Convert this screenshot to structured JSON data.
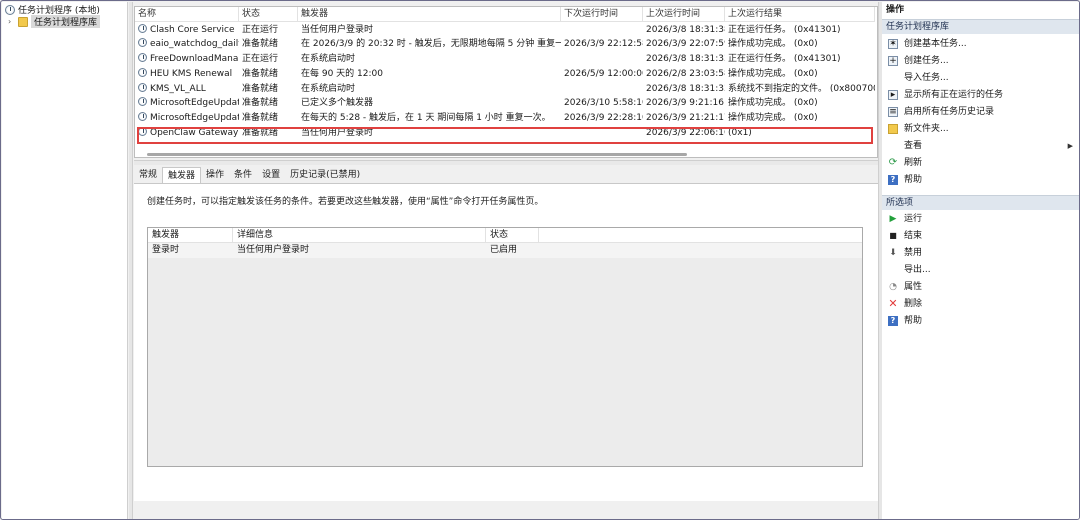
{
  "tree": {
    "root": "任务计划程序 (本地)",
    "library": "任务计划程序库"
  },
  "task_list": {
    "columns": [
      "名称",
      "状态",
      "触发器",
      "下次运行时间",
      "上次运行时间",
      "上次运行结果"
    ],
    "rows": [
      {
        "name": "Clash Core Service",
        "status": "正在运行",
        "trigger": "当任何用户登录时",
        "next": "",
        "last": "2026/3/8 18:31:38",
        "result": "正在运行任务。 (0x41301)"
      },
      {
        "name": "eaio_watchdog_daily",
        "status": "准备就绪",
        "trigger": "在 2026/3/9 的 20:32 时 - 触发后，无限期地每隔 5 分钟 重复一次。",
        "next": "2026/3/9 22:12:58",
        "last": "2026/3/9 22:07:59",
        "result": "操作成功完成。 (0x0)"
      },
      {
        "name": "FreeDownloadMana...",
        "status": "正在运行",
        "trigger": "在系统启动时",
        "next": "",
        "last": "2026/3/8 18:31:33",
        "result": "正在运行任务。 (0x41301)"
      },
      {
        "name": "HEU KMS Renewal",
        "status": "准备就绪",
        "trigger": "在每 90 天的 12:00",
        "next": "2026/5/9 12:00:00",
        "last": "2026/2/8 23:03:58",
        "result": "操作成功完成。 (0x0)"
      },
      {
        "name": "KMS_VL_ALL",
        "status": "准备就绪",
        "trigger": "在系统启动时",
        "next": "",
        "last": "2026/3/8 18:31:33",
        "result": "系统找不到指定的文件。 (0x80070002"
      },
      {
        "name": "MicrosoftEdgeUpdat...",
        "status": "准备就绪",
        "trigger": "已定义多个触发器",
        "next": "2026/3/10 5:58:10",
        "last": "2026/3/9 9:21:16",
        "result": "操作成功完成。 (0x0)"
      },
      {
        "name": "MicrosoftEdgeUpdat...",
        "status": "准备就绪",
        "trigger": "在每天的 5:28 - 触发后，在 1 天 期间每隔 1 小时 重复一次。",
        "next": "2026/3/9 22:28:10",
        "last": "2026/3/9 21:21:17",
        "result": "操作成功完成。 (0x0)"
      },
      {
        "name": "OpenClaw Gateway",
        "status": "准备就绪",
        "trigger": "当任何用户登录时",
        "next": "",
        "last": "2026/3/9 22:06:16",
        "result": "(0x1)"
      }
    ]
  },
  "detail": {
    "tabs": [
      "常规",
      "触发器",
      "操作",
      "条件",
      "设置",
      "历史记录(已禁用)"
    ],
    "active_tab": "触发器",
    "hint": "创建任务时，可以指定触发该任务的条件。若要更改这些触发器，使用“属性”命令打开任务属性页。",
    "trigger_table": {
      "columns": [
        "触发器",
        "详细信息",
        "状态"
      ],
      "rows": [
        {
          "trigger": "登录时",
          "details": "当任何用户登录时",
          "status": "已启用"
        }
      ]
    }
  },
  "actions": {
    "title": "操作",
    "section1": "任务计划程序库",
    "items1": [
      {
        "label": "创建基本任务...",
        "icon": "create-basic-task-icon"
      },
      {
        "label": "创建任务...",
        "icon": "create-task-icon"
      },
      {
        "label": "导入任务...",
        "icon": ""
      },
      {
        "label": "显示所有正在运行的任务",
        "icon": "running-tasks-icon"
      },
      {
        "label": "启用所有任务历史记录",
        "icon": "history-icon"
      },
      {
        "label": "新文件夹...",
        "icon": "folder-icon"
      },
      {
        "label": "查看",
        "icon": ""
      },
      {
        "label": "刷新",
        "icon": "refresh-icon"
      },
      {
        "label": "帮助",
        "icon": "help-icon"
      }
    ],
    "section2": "所选项",
    "items2": [
      {
        "label": "运行",
        "icon": "run-icon"
      },
      {
        "label": "结束",
        "icon": "stop-icon"
      },
      {
        "label": "禁用",
        "icon": "disable-icon"
      },
      {
        "label": "导出...",
        "icon": ""
      },
      {
        "label": "属性",
        "icon": "properties-icon"
      },
      {
        "label": "删除",
        "icon": "delete-icon"
      },
      {
        "label": "帮助",
        "icon": "help-icon"
      }
    ]
  }
}
